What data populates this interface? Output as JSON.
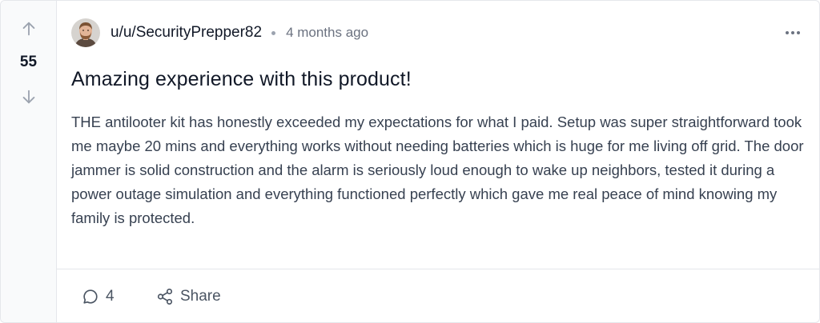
{
  "post": {
    "votes": "55",
    "author": "u/u/SecurityPrepper82",
    "time": "4 months ago",
    "title": "Amazing experience with this product!",
    "body": "THE antilooter kit has honestly exceeded my expectations for what I paid. Setup was super straightforward took me maybe 20 mins and everything works without needing batteries which is huge for me living off grid. The door jammer is solid construction and the alarm is seriously loud enough to wake up neighbors, tested it during a power outage simulation and everything functioned perfectly which gave me real peace of mind knowing my family is protected.",
    "comment_count": "4",
    "share_label": "Share"
  },
  "icons": {
    "upvote": "arrow-up-icon",
    "downvote": "arrow-down-icon",
    "more": "more-horizontal-icon",
    "comment": "comment-bubble-icon",
    "share": "share-icon"
  },
  "colors": {
    "vote_column_bg": "#f9fafb",
    "border": "#e5e7eb",
    "text_primary": "#111827",
    "text_muted": "#6b7280"
  }
}
